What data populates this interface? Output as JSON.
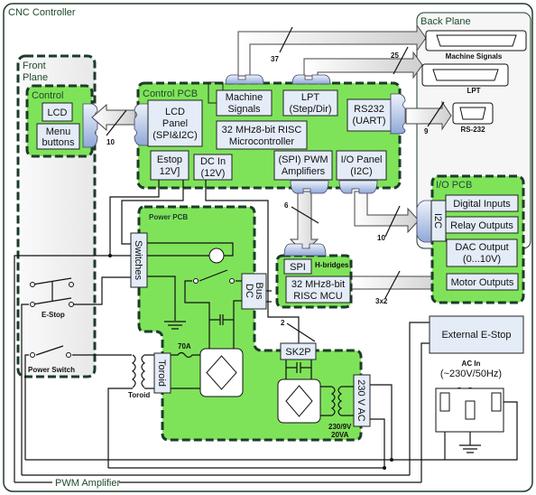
{
  "title": "CNC Controller",
  "colors": {
    "pcb_green": "#7fe35a",
    "border": "#1d3b2a",
    "box_fill": "#e4ecf7"
  },
  "front_plane": {
    "label_line1": "Front",
    "label_line2": "Plane",
    "control": {
      "label": "Control",
      "lcd": "LCD",
      "menu_line1": "Menu",
      "menu_line2": "buttons"
    },
    "estop_label": "E-Stop",
    "power_switch_label": "Power Switch"
  },
  "control_pcb": {
    "label": "Control PCB",
    "lcd_panel": [
      "LCD",
      "Panel",
      "(SPI&I2C)"
    ],
    "machine_signals": [
      "Machine",
      "Signals"
    ],
    "lpt": [
      "LPT",
      "(Step/Dir)"
    ],
    "rs232": [
      "RS232",
      "(UART)"
    ],
    "mcu": [
      "32 MHz8-bit RISC",
      "Microcontroller"
    ],
    "estop": [
      "Estop",
      "12V]"
    ],
    "dc_in": [
      "DC In",
      "(12V)"
    ],
    "pwm": [
      "(SPI) PWM",
      "Amplifiers"
    ],
    "io_panel": [
      "I/O Panel",
      "(I2C)"
    ]
  },
  "back_plane": {
    "label": "Back Plane",
    "machine_signals": "Machine Signals",
    "lpt": "LPT",
    "rs232": "RS-232",
    "external_estop": "External E-Stop",
    "ac_in": "AC In",
    "ac_spec": "(~230V/50Hz)"
  },
  "io_pcb": {
    "label": "I/O PCB",
    "i2c": "I2C",
    "digital_inputs": "Digital Inputs",
    "relay_outputs": "Relay Outputs",
    "dac_output": [
      "DAC Output",
      "(0...10V)"
    ],
    "motor_outputs": "Motor Outputs"
  },
  "hbridges": {
    "label": "H-bridges",
    "spi": "SPI",
    "mcu": [
      "32 MHz8-bit",
      "RISC MCU"
    ]
  },
  "power_pcb": {
    "label": "Power PCB",
    "switches": "Switches",
    "dc_bus": [
      "DC",
      "Bus"
    ],
    "toroid": "Toroid",
    "fuse": "70A",
    "sk2p": "SK2P",
    "ac_box": "230 V AC",
    "transformer": [
      "230/9V",
      "20VA"
    ],
    "toroid_label": "Toroid"
  },
  "bus_counts": {
    "lcd": "10",
    "machine": "37",
    "lpt": "25",
    "rs232": "9",
    "pwm": "6",
    "io": "10",
    "motor": "3x2",
    "sk2p": "2"
  },
  "bottom_label": "PWM Amplifier"
}
